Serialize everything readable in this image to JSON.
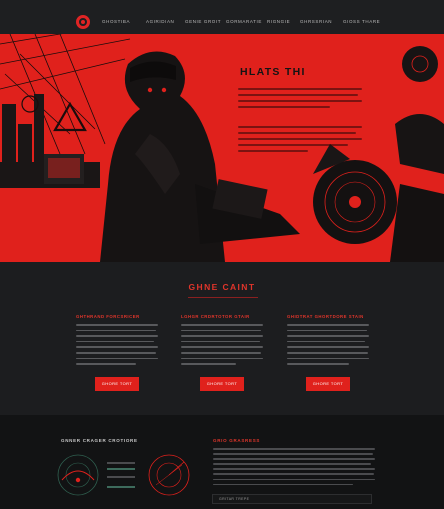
{
  "nav": {
    "items": [
      "GHOSTIBA",
      "AGIRIDIAN",
      "GENIE GROIT",
      "GORMARATIE",
      "RIGNGIE",
      "GHRSSRIAN",
      "GIOSS THARE"
    ]
  },
  "hero": {
    "title": "HLATS THI"
  },
  "features": {
    "title": "GHNE CAINT",
    "columns": [
      {
        "heading": "GHTHRAND FORCSRICER",
        "button": "GHORE TORT"
      },
      {
        "heading": "LGHGR CRDRTOTOR GTAIR",
        "button": "GHORE TORT"
      },
      {
        "heading": "GHIDTRAT GHORTDORE STAIN",
        "button": "GHORE TORT"
      }
    ]
  },
  "bottom": {
    "left_heading": "GNNER CRAGER CROTIORE",
    "right_heading": "GRIO GRASRESS",
    "input_label": "GRITAR TREPE"
  },
  "colors": {
    "accent": "#e0211c",
    "background": "#1c1d1f",
    "footer": "#121314"
  }
}
